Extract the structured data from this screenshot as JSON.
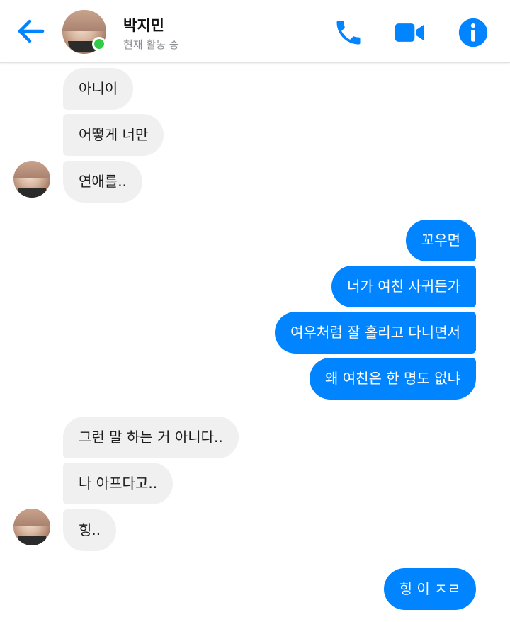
{
  "header": {
    "name": "박지민",
    "status": "현재 활동 중",
    "accent_color": "#0084ff",
    "online_color": "#31cc46",
    "icons": [
      "back-arrow-icon",
      "phone-icon",
      "video-camera-icon",
      "info-icon"
    ]
  },
  "messages": [
    {
      "from": "them",
      "text": "아니이"
    },
    {
      "from": "them",
      "text": "어떻게 너만"
    },
    {
      "from": "them",
      "text": "연애를.."
    },
    {
      "from": "me",
      "text": "꼬우면"
    },
    {
      "from": "me",
      "text": "너가 여친 사귀든가"
    },
    {
      "from": "me",
      "text": "여우처럼 잘 홀리고 다니면서"
    },
    {
      "from": "me",
      "text": "왜 여친은 한 명도 없냐"
    },
    {
      "from": "them",
      "text": "그런 말 하는 거 아니다.."
    },
    {
      "from": "them",
      "text": "나 아프다고.."
    },
    {
      "from": "them",
      "text": "힝.."
    },
    {
      "from": "me",
      "text": "힝 이 ㅈㄹ"
    }
  ]
}
